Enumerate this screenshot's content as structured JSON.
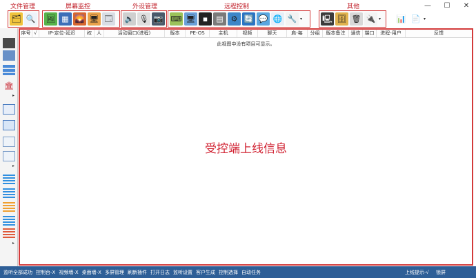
{
  "window": {
    "minimize": "—",
    "maximize": "☐",
    "close": "✕"
  },
  "groups": {
    "file_mgmt": "文件管理",
    "screen_monitor": "屏幕监控",
    "peripheral_mgmt": "外设管理",
    "remote_control": "远程控制",
    "other": "其他"
  },
  "icons": {
    "file_manager": "🗂",
    "file_search": "🔍",
    "screen_view": "🖼",
    "multi_screen": "▦",
    "screen_capture": "🌄",
    "screen_record": "🖥",
    "screen_wall": "🗔",
    "speaker": "🔈",
    "microphone": "🎙",
    "webcam": "📷",
    "remote_shell": "⌨",
    "remote_desktop": "🖥",
    "terminal": "▪",
    "keylogger": "▤",
    "process_mgr": "⚙",
    "network": "🔄",
    "chat": "💬",
    "browser": "🌐",
    "tools": "🔧",
    "system_info": "🖳",
    "registry": "🗄",
    "trash": "🗑",
    "plugin": "🔌",
    "bar_chart": "📊",
    "document": "📄"
  },
  "sidebar": {
    "arrow": "▸"
  },
  "table": {
    "columns": [
      "序号",
      "√",
      "IP-定位-延迟",
      "权",
      "人",
      "活动窗口(进程)",
      "版本",
      "PE-OS",
      "主机",
      "视频",
      "聊天",
      "肩-每",
      "分组",
      "版本备注",
      "通信",
      "端口",
      "进程-用户",
      "反馈"
    ],
    "empty_message": "此视图中没有项目可显示。"
  },
  "overlay_text": "受控端上线信息",
  "statusbar": {
    "items": [
      "监听全部成功",
      "控制台-X",
      "视频墙-X",
      "桌面墙-X",
      "多屏管理",
      "刷新插件",
      "打开日志",
      "监听设置",
      "客户生成",
      "控制选择",
      "自动任务"
    ],
    "right": [
      "上线提示-√",
      "锁屏"
    ]
  },
  "colors": {
    "accent_red": "#d33a3a",
    "status_blue": "#2e5f97"
  }
}
